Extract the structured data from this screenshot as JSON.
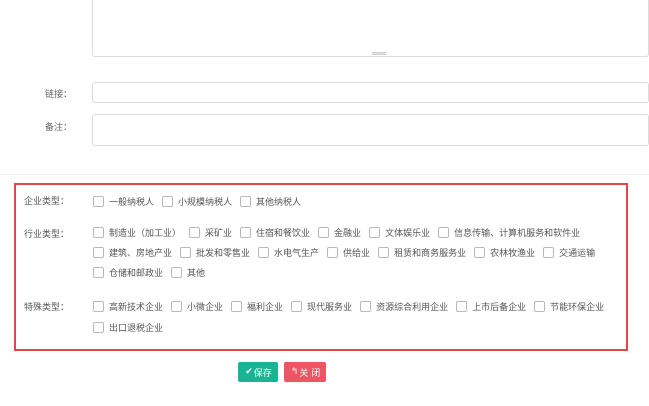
{
  "form": {
    "link_label": "链接：",
    "link_value": "",
    "remark_label": "备注：",
    "remark_value": ""
  },
  "enterprise_type": {
    "label": "企业类型：",
    "options": [
      "一般纳税人",
      "小规模纳税人",
      "其他纳税人"
    ]
  },
  "industry_type": {
    "label": "行业类型：",
    "options": [
      "制造业（加工业）",
      "采矿业",
      "住宿和餐饮业",
      "金融业",
      "文体娱乐业",
      "信息传输、计算机服务和软件业",
      "建筑、房地产业",
      "批发和零售业",
      "水电气生产",
      "供给业",
      "租赁和商务服务业",
      "农林牧渔业",
      "交通运输",
      "仓储和邮政业",
      "其他"
    ]
  },
  "special_type": {
    "label": "特殊类型：",
    "options": [
      "高新技术企业",
      "小微企业",
      "福利企业",
      "现代服务业",
      "资源综合利用企业",
      "上市后备企业",
      "节能环保企业",
      "出口退税企业"
    ]
  },
  "buttons": {
    "save_icon": "✔",
    "save_label": "保存",
    "close_icon": "↰",
    "close_label": "关 闭"
  },
  "colors": {
    "save": "#1ab394",
    "close": "#ed5565",
    "highlight": "#e04848"
  }
}
